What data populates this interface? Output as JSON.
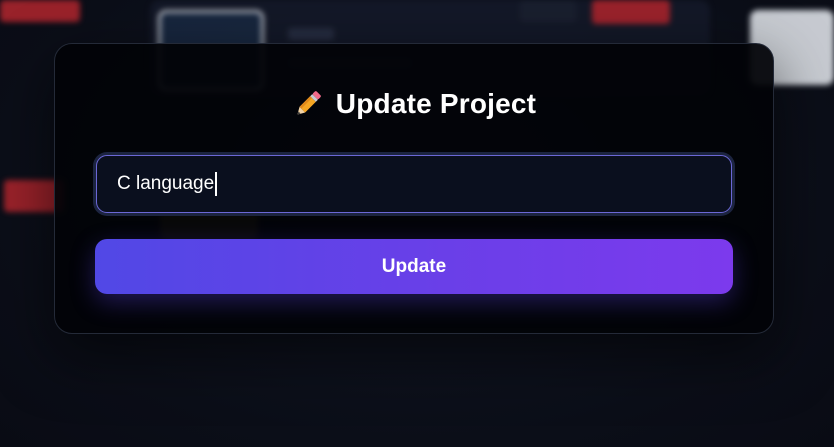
{
  "modal": {
    "title": "Update Project",
    "title_icon": "pencil-icon"
  },
  "form": {
    "project_name_value": "C language",
    "submit_label": "Update"
  },
  "colors": {
    "button_gradient_start": "#5148e6",
    "button_gradient_end": "#7c3aed",
    "input_border": "#6b67d6",
    "background": "#0c0f1a"
  }
}
